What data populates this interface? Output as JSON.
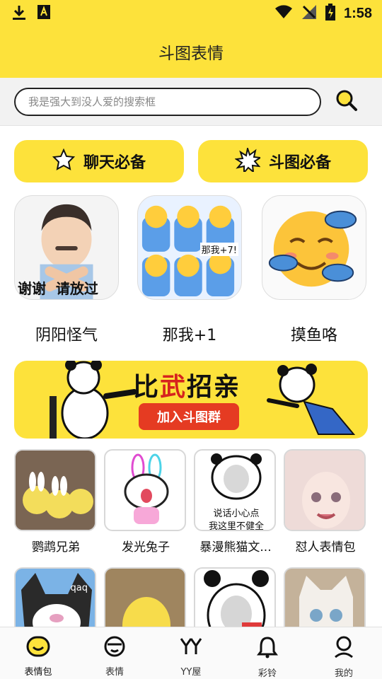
{
  "status_bar": {
    "time": "1:58"
  },
  "header": {
    "title": "斗图表情"
  },
  "search": {
    "placeholder": "我是强大到没人爱的搜索框"
  },
  "quick_buttons": [
    {
      "label": "聊天必备",
      "icon": "star-outline-icon"
    },
    {
      "label": "斗图必备",
      "icon": "burst-icon"
    }
  ],
  "categories": [
    {
      "name": "阴阳怪气",
      "caption": "谢谢  请放过"
    },
    {
      "name": "那我+1",
      "caption": "那我+7!"
    },
    {
      "name": "摸鱼咯"
    }
  ],
  "banner": {
    "slogan_a": "比",
    "slogan_b": "武",
    "slogan_c": "招亲",
    "button": "加入斗图群"
  },
  "packs_row1": [
    {
      "name": "鹦鹉兄弟"
    },
    {
      "name": "发光兔子"
    },
    {
      "name": "暴漫熊猫文...",
      "caption_line1": "说话小心点",
      "caption_line2": "我这里不健全"
    },
    {
      "name": "怼人表情包"
    }
  ],
  "packs_row2": [
    {
      "name": "",
      "caption": "qaq"
    },
    {
      "name": ""
    },
    {
      "name": ""
    },
    {
      "name": ""
    }
  ],
  "tabs": [
    {
      "label": "表情包",
      "icon": "smiley-icon",
      "active": true
    },
    {
      "label": "表情",
      "icon": "face-icon"
    },
    {
      "label": "YY屋",
      "icon": "yy-icon"
    },
    {
      "label": "彩铃",
      "icon": "bell-icon"
    },
    {
      "label": "我的",
      "icon": "person-icon"
    }
  ]
}
